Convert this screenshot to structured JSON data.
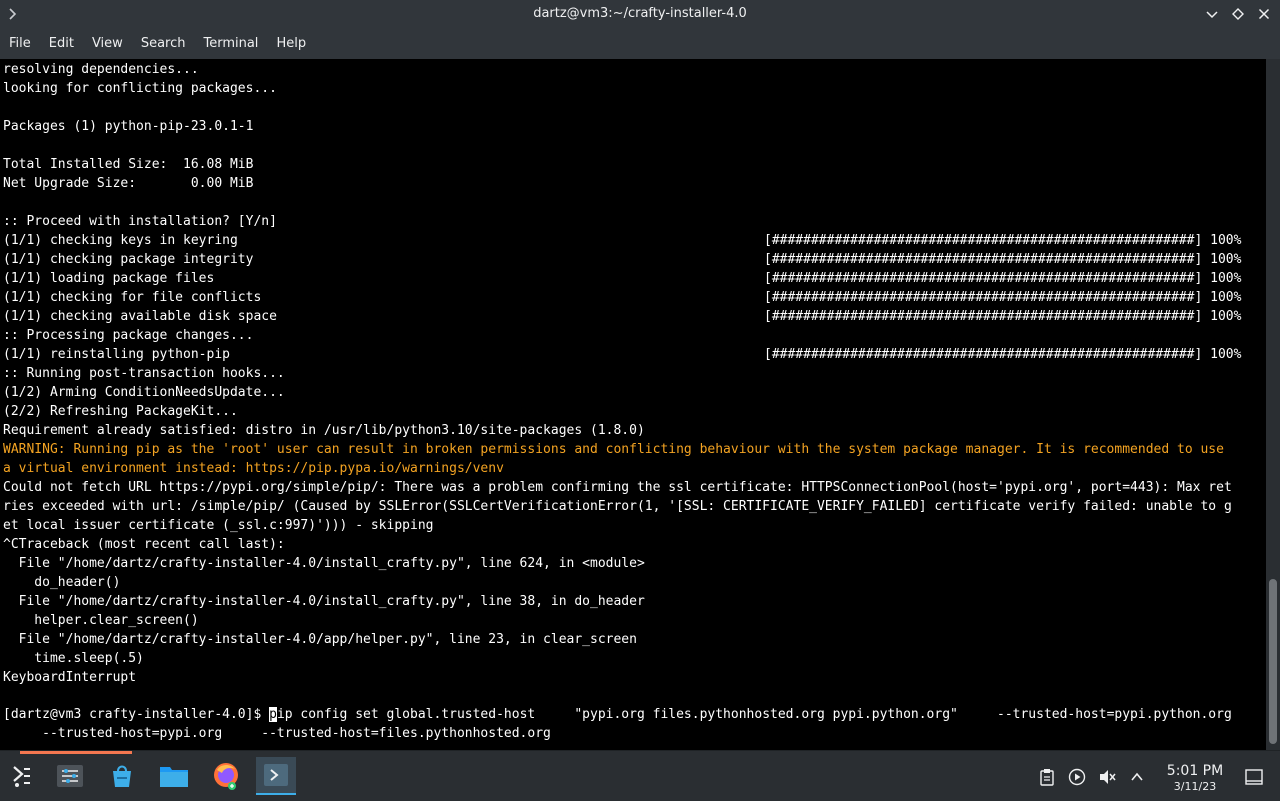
{
  "window": {
    "title": "dartz@vm3:~/crafty-installer-4.0",
    "app_icon": "terminal-chevron-icon"
  },
  "menu": [
    "File",
    "Edit",
    "View",
    "Search",
    "Terminal",
    "Help"
  ],
  "terminal": {
    "lines": [
      {
        "text": "resolving dependencies...",
        "style": "normal"
      },
      {
        "text": "looking for conflicting packages...",
        "style": "normal"
      },
      {
        "text": "",
        "style": "normal"
      },
      {
        "text": "Packages (1) python-pip-23.0.1-1",
        "style": "normal"
      },
      {
        "text": "",
        "style": "normal"
      },
      {
        "text": "Total Installed Size:  16.08 MiB",
        "style": "normal"
      },
      {
        "text": "Net Upgrade Size:       0.00 MiB",
        "style": "normal"
      },
      {
        "text": "",
        "style": "normal"
      },
      {
        "text": ":: Proceed with installation? [Y/n]",
        "style": "normal"
      },
      {
        "text": "(1/1) checking keys in keyring",
        "style": "normal"
      },
      {
        "text": "(1/1) checking package integrity",
        "style": "normal"
      },
      {
        "text": "(1/1) loading package files",
        "style": "normal"
      },
      {
        "text": "(1/1) checking for file conflicts",
        "style": "normal"
      },
      {
        "text": "(1/1) checking available disk space",
        "style": "normal"
      },
      {
        "text": ":: Processing package changes...",
        "style": "normal"
      },
      {
        "text": "(1/1) reinstalling python-pip",
        "style": "normal"
      },
      {
        "text": ":: Running post-transaction hooks...",
        "style": "normal"
      },
      {
        "text": "(1/2) Arming ConditionNeedsUpdate...",
        "style": "normal"
      },
      {
        "text": "(2/2) Refreshing PackageKit...",
        "style": "normal"
      },
      {
        "text": "Requirement already satisfied: distro in /usr/lib/python3.10/site-packages (1.8.0)",
        "style": "normal"
      },
      {
        "text": "WARNING: Running pip as the 'root' user can result in broken permissions and conflicting behaviour with the system package manager. It is recommended to use",
        "style": "warn"
      },
      {
        "text": "a virtual environment instead: https://pip.pypa.io/warnings/venv",
        "style": "warn"
      },
      {
        "text": "Could not fetch URL https://pypi.org/simple/pip/: There was a problem confirming the ssl certificate: HTTPSConnectionPool(host='pypi.org', port=443): Max ret",
        "style": "normal"
      },
      {
        "text": "ries exceeded with url: /simple/pip/ (Caused by SSLError(SSLCertVerificationError(1, '[SSL: CERTIFICATE_VERIFY_FAILED] certificate verify failed: unable to g",
        "style": "normal"
      },
      {
        "text": "et local issuer certificate (_ssl.c:997)'))) - skipping",
        "style": "normal"
      },
      {
        "text": "^CTraceback (most recent call last):",
        "style": "normal"
      },
      {
        "text": "  File \"/home/dartz/crafty-installer-4.0/install_crafty.py\", line 624, in <module>",
        "style": "normal"
      },
      {
        "text": "    do_header()",
        "style": "normal"
      },
      {
        "text": "  File \"/home/dartz/crafty-installer-4.0/install_crafty.py\", line 38, in do_header",
        "style": "normal"
      },
      {
        "text": "    helper.clear_screen()",
        "style": "normal"
      },
      {
        "text": "  File \"/home/dartz/crafty-installer-4.0/app/helper.py\", line 23, in clear_screen",
        "style": "normal"
      },
      {
        "text": "    time.sleep(.5)",
        "style": "normal"
      },
      {
        "text": "KeyboardInterrupt",
        "style": "normal"
      },
      {
        "text": "",
        "style": "normal"
      }
    ],
    "progress_bar_text": "[######################################################] 100%",
    "progress_rows": [
      9,
      10,
      11,
      12,
      13,
      15
    ],
    "prompt": "[dartz@vm3 crafty-installer-4.0]$ ",
    "cursor_char": "p",
    "command_rest": "ip config set global.trusted-host     \"pypi.org files.pythonhosted.org pypi.python.org\"     --trusted-host=pypi.python.org",
    "command_wrap": "     --trusted-host=pypi.org     --trusted-host=files.pythonhosted.org"
  },
  "taskbar": {
    "items": [
      {
        "name": "app-launcher-icon"
      },
      {
        "name": "system-settings-icon"
      },
      {
        "name": "discover-store-icon"
      },
      {
        "name": "file-manager-icon"
      },
      {
        "name": "firefox-icon"
      },
      {
        "name": "konsole-icon"
      }
    ],
    "tray": [
      "clipboard-icon",
      "media-play-icon",
      "volume-muted-icon",
      "chevron-up-icon"
    ],
    "time": "5:01 PM",
    "date": "3/11/23"
  },
  "colors": {
    "warning": "#f3a322",
    "accent": "#3daee9"
  }
}
